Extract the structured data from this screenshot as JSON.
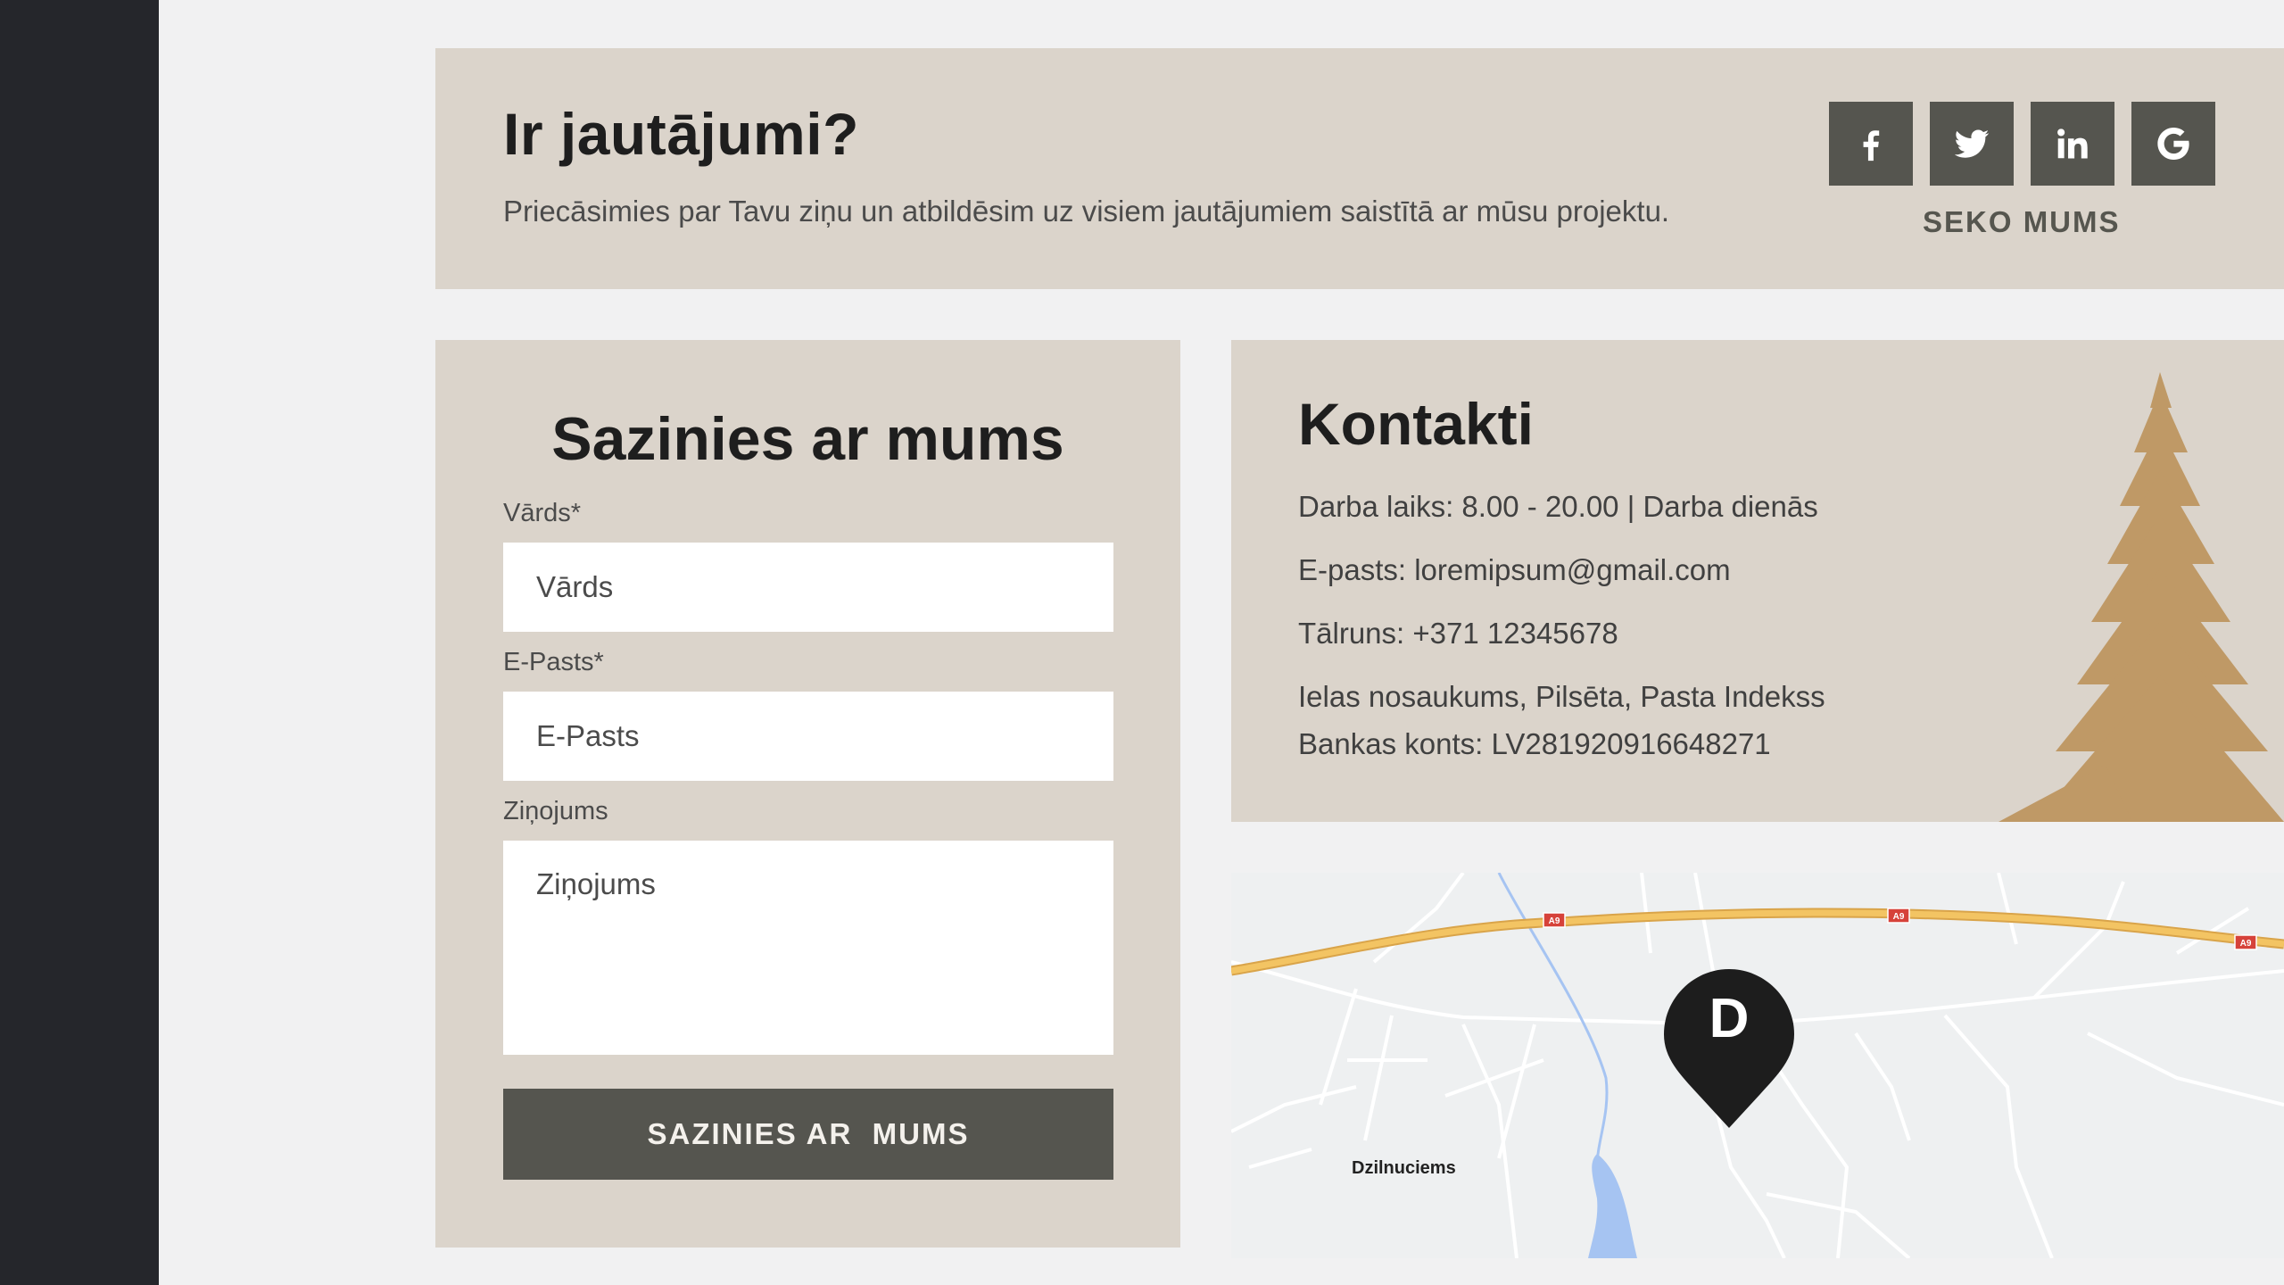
{
  "header": {
    "title": "Ir jautājumi?",
    "subtitle": "Priecāsimies par Tavu ziņu un atbildēsim uz visiem jautājumiem saistītā ar mūsu projektu.",
    "social": [
      {
        "name": "facebook-icon"
      },
      {
        "name": "twitter-icon"
      },
      {
        "name": "linkedin-icon"
      },
      {
        "name": "google-icon"
      }
    ],
    "follow_label": "SEKO MUMS"
  },
  "form": {
    "title": "Sazinies ar mums",
    "name_label": "Vārds*",
    "name_placeholder": "Vārds",
    "email_label": "E-Pasts*",
    "email_placeholder": "E-Pasts",
    "message_label": "Ziņojums",
    "message_placeholder": "Ziņojums",
    "submit_label": "SAZINIES AR  MUMS"
  },
  "contacts": {
    "title": "Kontakti",
    "hours": "Darba laiks: 8.00 - 20.00 | Darba dienās",
    "email": "E-pasts: loremipsum@gmail.com",
    "phone": "Tālruns: +371 12345678",
    "address": "Ielas nosaukums, Pilsēta, Pasta Indekss",
    "bank": "Bankas konts: LV281920916648271"
  },
  "map": {
    "road_label": "A9",
    "place_name": "Dzilnuciems",
    "marker_letter": "D"
  },
  "colors": {
    "sidebar": "#25262b",
    "page_bg": "#f1f1f2",
    "card_bg": "#dbd4cb",
    "button_bg": "#55554f",
    "tree": "#bf9966",
    "road": "#f3c463",
    "water": "#a6c4f2"
  }
}
